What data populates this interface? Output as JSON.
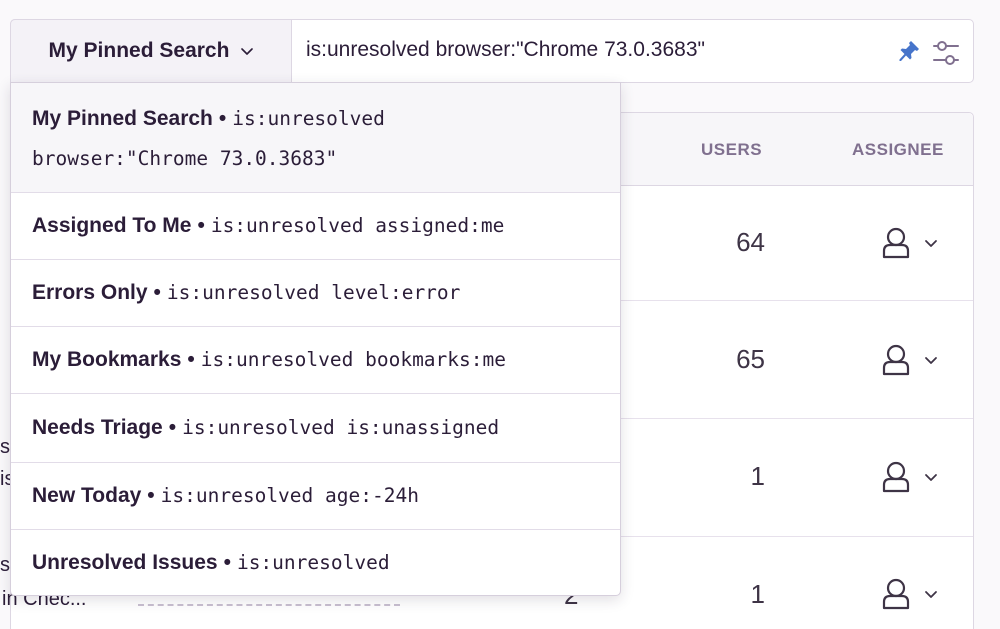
{
  "search": {
    "pinned_label": "My Pinned Search",
    "query": "is:unresolved browser:\"Chrome 73.0.3683\""
  },
  "table": {
    "col_users": "USERS",
    "col_assignee": "ASSIGNEE",
    "rows": [
      {
        "users": "64"
      },
      {
        "users": "65"
      },
      {
        "users": "1"
      },
      {
        "users": "1"
      }
    ],
    "partial_text_1": "s",
    "partial_text_2": "is",
    "partial_text_3": "s",
    "partial_text_4": "in Chec...",
    "partial_events": "2"
  },
  "dropdown": {
    "items": [
      {
        "name": "My Pinned Search",
        "query_line1": "is:unresolved",
        "query_line2": "browser:\"Chrome 73.0.3683\""
      },
      {
        "name": "Assigned To Me",
        "query": "is:unresolved assigned:me"
      },
      {
        "name": "Errors Only",
        "query": "is:unresolved level:error"
      },
      {
        "name": "My Bookmarks",
        "query": "is:unresolved bookmarks:me"
      },
      {
        "name": "Needs Triage",
        "query": "is:unresolved is:unassigned"
      },
      {
        "name": "New Today",
        "query": "is:unresolved age:-24h"
      },
      {
        "name": "Unresolved Issues",
        "query": "is:unresolved"
      }
    ]
  },
  "icons": {
    "pin": "pin-icon",
    "sliders": "sliders-icon",
    "avatar": "user-icon",
    "chevron": "chevron-down-icon"
  },
  "colors": {
    "pin": "#4674ca",
    "text": "#2b1d38",
    "muted": "#80708f"
  }
}
